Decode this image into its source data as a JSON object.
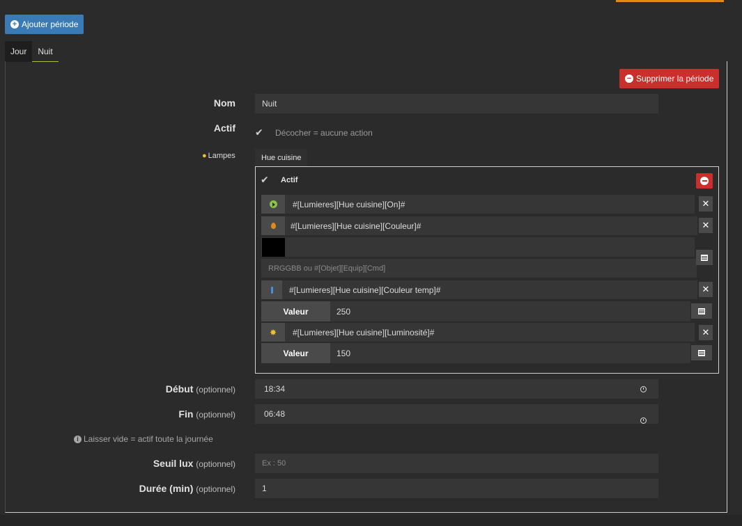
{
  "toolbar": {
    "add_period_label": "Ajouter période"
  },
  "tabs": [
    {
      "label": "Jour",
      "active": false
    },
    {
      "label": "Nuit",
      "active": true
    }
  ],
  "delete_period_label": "Supprimer la période",
  "form": {
    "nom_label": "Nom",
    "nom_value": "Nuit",
    "actif_label": "Actif",
    "actif_hint": "Décocher = aucune action",
    "lampes_label": "Lampes",
    "lamp_tab_label": "Hue cuisine",
    "lamp": {
      "actif_label": "Actif",
      "cmd_on": "#[Lumieres][Hue cuisine][On]#",
      "cmd_couleur": "#[Lumieres][Hue cuisine][Couleur]#",
      "color_swatch": "#000000",
      "color_placeholder": "RRGGBB ou #[Objet][Equip][Cmd]",
      "cmd_couleur_temp": "#[Lumieres][Hue cuisine][Couleur temp]#",
      "couleur_temp_valeur_label": "Valeur",
      "couleur_temp_valeur": "250",
      "cmd_luminosite": "#[Lumieres][Hue cuisine][Luminosité]#",
      "luminosite_valeur_label": "Valeur",
      "luminosite_valeur": "150"
    },
    "debut_label": "Début",
    "debut_opt": "(optionnel)",
    "debut_value": "18:34",
    "fin_label": "Fin",
    "fin_opt": "(optionnel)",
    "fin_value": "06:48",
    "info_text": "Laisser vide = actif toute la journée",
    "seuil_label": "Seuil lux",
    "seuil_opt": "(optionnel)",
    "seuil_placeholder": "Ex : 50",
    "duree_label": "Durée (min)",
    "duree_opt": "(optionnel)",
    "duree_value": "1"
  },
  "colors": {
    "primary": "#3a7bb5",
    "danger": "#c9302c",
    "accent": "#e08a1e",
    "tab_underline": "#a8c13a"
  }
}
